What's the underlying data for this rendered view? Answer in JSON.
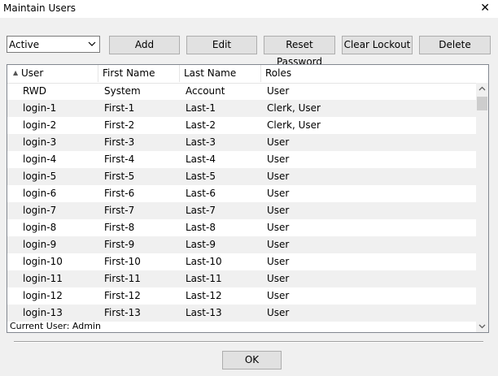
{
  "window": {
    "title": "Maintain Users",
    "close_glyph": "✕"
  },
  "filter": {
    "selected": "Active"
  },
  "toolbar": {
    "add_label": "Add",
    "edit_label": "Edit",
    "reset_password_label": "Reset Password",
    "clear_lockout_label": "Clear Lockout",
    "delete_label": "Delete"
  },
  "table": {
    "columns": [
      "User",
      "First Name",
      "Last Name",
      "Roles"
    ],
    "rows": [
      [
        "RWD",
        "System",
        "Account",
        "User"
      ],
      [
        "login-1",
        "First-1",
        "Last-1",
        "Clerk, User"
      ],
      [
        "login-2",
        "First-2",
        "Last-2",
        "Clerk, User"
      ],
      [
        "login-3",
        "First-3",
        "Last-3",
        "User"
      ],
      [
        "login-4",
        "First-4",
        "Last-4",
        "User"
      ],
      [
        "login-5",
        "First-5",
        "Last-5",
        "User"
      ],
      [
        "login-6",
        "First-6",
        "Last-6",
        "User"
      ],
      [
        "login-7",
        "First-7",
        "Last-7",
        "User"
      ],
      [
        "login-8",
        "First-8",
        "Last-8",
        "User"
      ],
      [
        "login-9",
        "First-9",
        "Last-9",
        "User"
      ],
      [
        "login-10",
        "First-10",
        "Last-10",
        "User"
      ],
      [
        "login-11",
        "First-11",
        "Last-11",
        "User"
      ],
      [
        "login-12",
        "First-12",
        "Last-12",
        "User"
      ],
      [
        "login-13",
        "First-13",
        "Last-13",
        "User"
      ]
    ]
  },
  "status": {
    "current_user": "Current User: Admin"
  },
  "footer": {
    "ok_label": "OK"
  }
}
